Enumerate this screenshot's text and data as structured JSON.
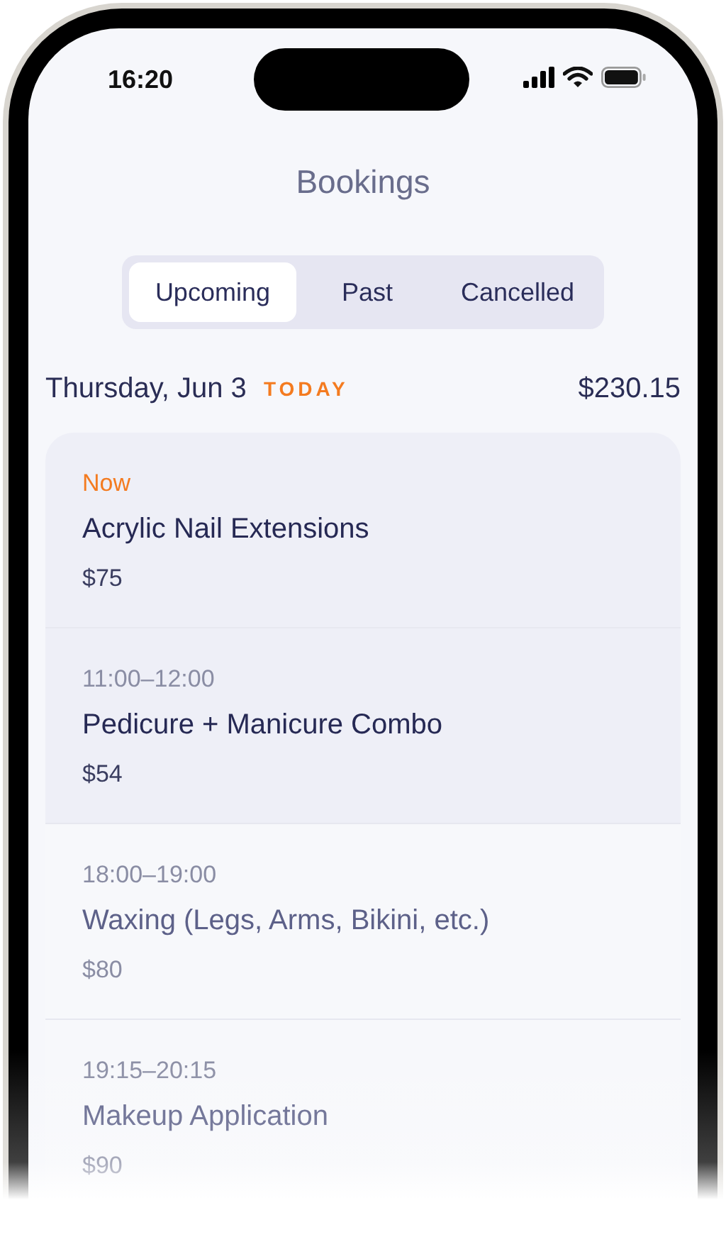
{
  "status_bar": {
    "time": "16:20"
  },
  "title": "Bookings",
  "tabs": [
    {
      "label": "Upcoming",
      "selected": true
    },
    {
      "label": "Past",
      "selected": false
    },
    {
      "label": "Cancelled",
      "selected": false
    }
  ],
  "day": {
    "date": "Thursday, Jun 3",
    "badge": "TODAY",
    "total": "$230.15"
  },
  "bookings": [
    {
      "time": "Now",
      "kind": "now",
      "service": "Acrylic Nail Extensions",
      "price": "$75",
      "highlighted": true
    },
    {
      "time": "11:00–12:00",
      "kind": "slot",
      "service": "Pedicure + Manicure Combo",
      "price": "$54",
      "highlighted": true
    },
    {
      "time": "18:00–19:00",
      "kind": "slot",
      "service": "Waxing (Legs, Arms, Bikini, etc.)",
      "price": "$80",
      "highlighted": false
    },
    {
      "time": "19:15–20:15",
      "kind": "slot",
      "service": "Makeup Application",
      "price": "$90",
      "highlighted": false
    }
  ]
}
